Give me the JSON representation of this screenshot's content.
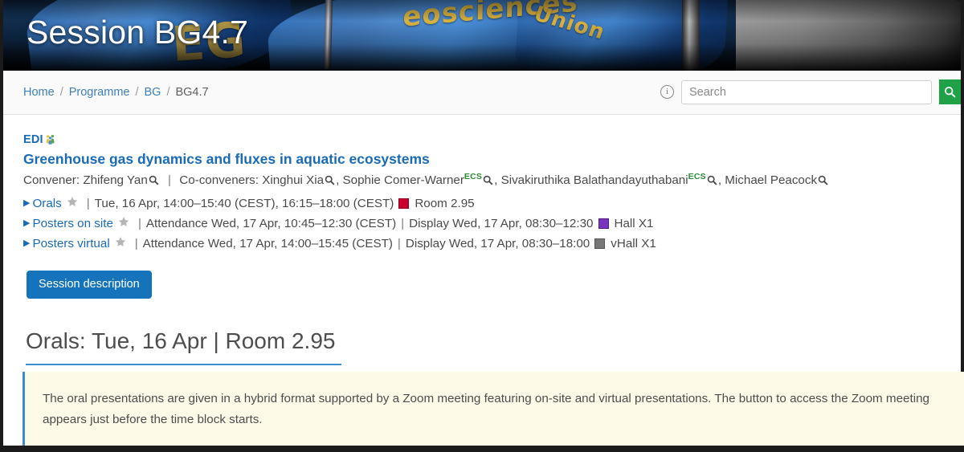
{
  "hero": {
    "title": "Session BG4.7",
    "banner_text_1": "eosciences",
    "banner_text_2": "Union",
    "banner_text_3": "EG"
  },
  "breadcrumb": {
    "items": [
      {
        "label": "Home",
        "link": true
      },
      {
        "label": "Programme",
        "link": true
      },
      {
        "label": "BG",
        "link": true
      },
      {
        "label": "BG4.7",
        "link": false
      }
    ],
    "separator": "/"
  },
  "search": {
    "placeholder": "Search",
    "info_icon": "info-icon",
    "button_icon": "search-icon",
    "button_color": "#1fa148"
  },
  "session": {
    "edi_label": "EDI",
    "edi_icon": "edi-diversity-icon",
    "title": "Greenhouse gas dynamics and fluxes in aquatic ecosystems",
    "convener_prefix": "Convener:",
    "convener": "Zhifeng Yan",
    "coconvener_prefix": "Co-conveners:",
    "coconveners": [
      {
        "name": "Xinghui Xia",
        "ecs": false
      },
      {
        "name": "Sophie Comer-Warner",
        "ecs": true
      },
      {
        "name": "Sivakiruthika Balathandayuthabani",
        "ecs": true
      },
      {
        "name": "Michael Peacock",
        "ecs": false
      }
    ],
    "ecs_badge": "ECS",
    "separator_pipe": "|"
  },
  "schedule": [
    {
      "label": "Orals",
      "star": "star-icon",
      "details": "Tue, 16 Apr, 14:00–15:40 (CEST), 16:15–18:00 (CEST)",
      "room": "Room 2.95",
      "room_color": "#c9002b",
      "swatch_class": "sw-red"
    },
    {
      "label": "Posters on site",
      "star": "star-icon",
      "details": "Attendance Wed, 17 Apr, 10:45–12:30 (CEST)",
      "details2": "Display Wed, 17 Apr, 08:30–12:30",
      "room": "Hall X1",
      "room_color": "#7b34bd",
      "swatch_class": "sw-purple"
    },
    {
      "label": "Posters virtual",
      "star": "star-icon",
      "details": "Attendance Wed, 17 Apr, 14:00–15:45 (CEST)",
      "details2": "Display Wed, 17 Apr, 08:30–18:00",
      "room": "vHall X1",
      "room_color": "#777777",
      "swatch_class": "sw-gray"
    }
  ],
  "buttons": {
    "session_description": "Session description"
  },
  "orals": {
    "heading": "Orals: Tue, 16 Apr | Room 2.95",
    "note": "The oral presentations are given in a hybrid format supported by a Zoom meeting featuring on-site and virtual presentations. The button to access the Zoom meeting appears just before the time block starts."
  }
}
